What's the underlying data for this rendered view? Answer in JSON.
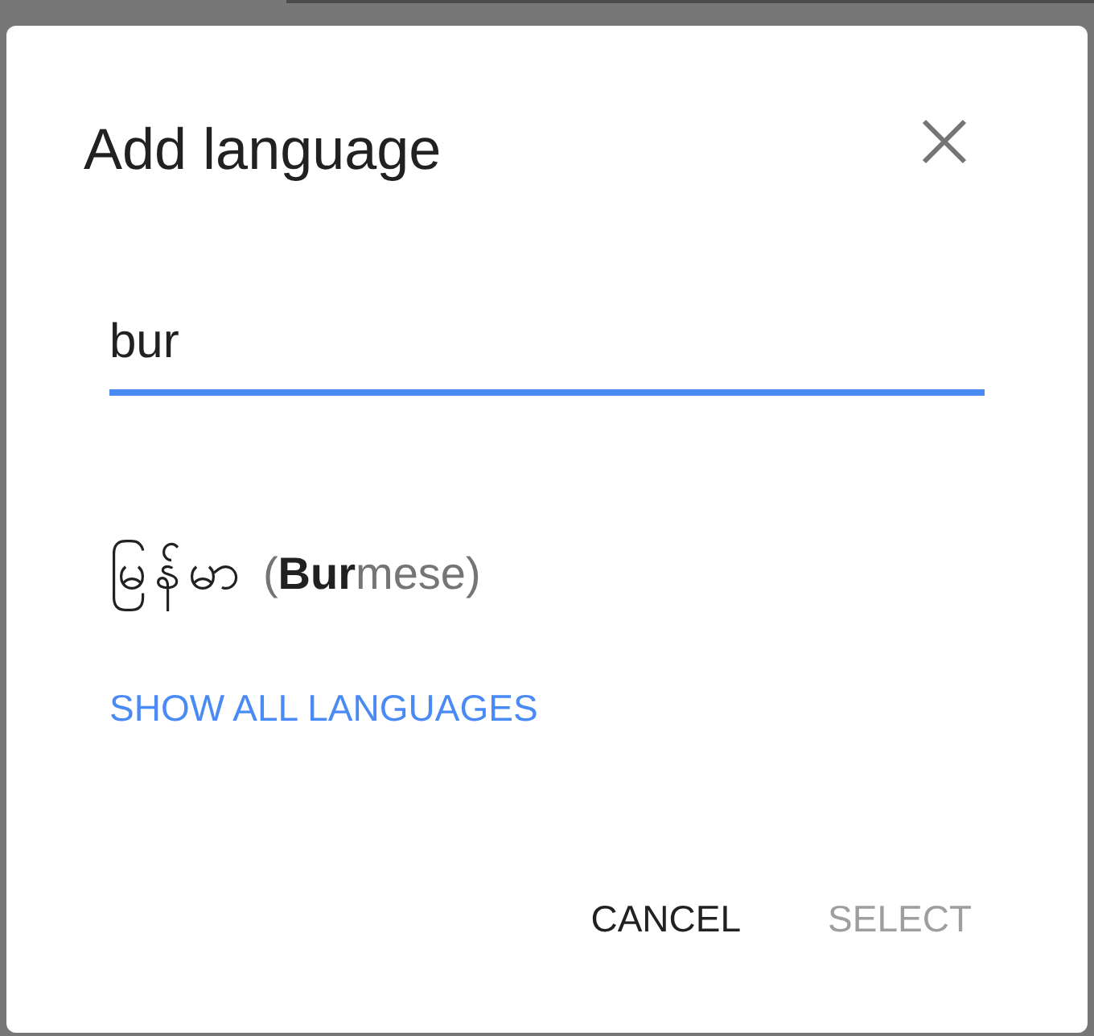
{
  "dialog": {
    "title": "Add language",
    "search": {
      "value": "bur",
      "focused": true
    },
    "results": [
      {
        "native_name": "မြန်မာ",
        "english_name": "(**Bur**mese)",
        "selected": false
      }
    ],
    "show_all_link": "SHOW ALL LANGUAGES",
    "buttons": [
      {
        "label": "CANCEL",
        "disabled": false
      },
      {
        "label": "SELECT",
        "disabled": true
      }
    ]
  }
}
